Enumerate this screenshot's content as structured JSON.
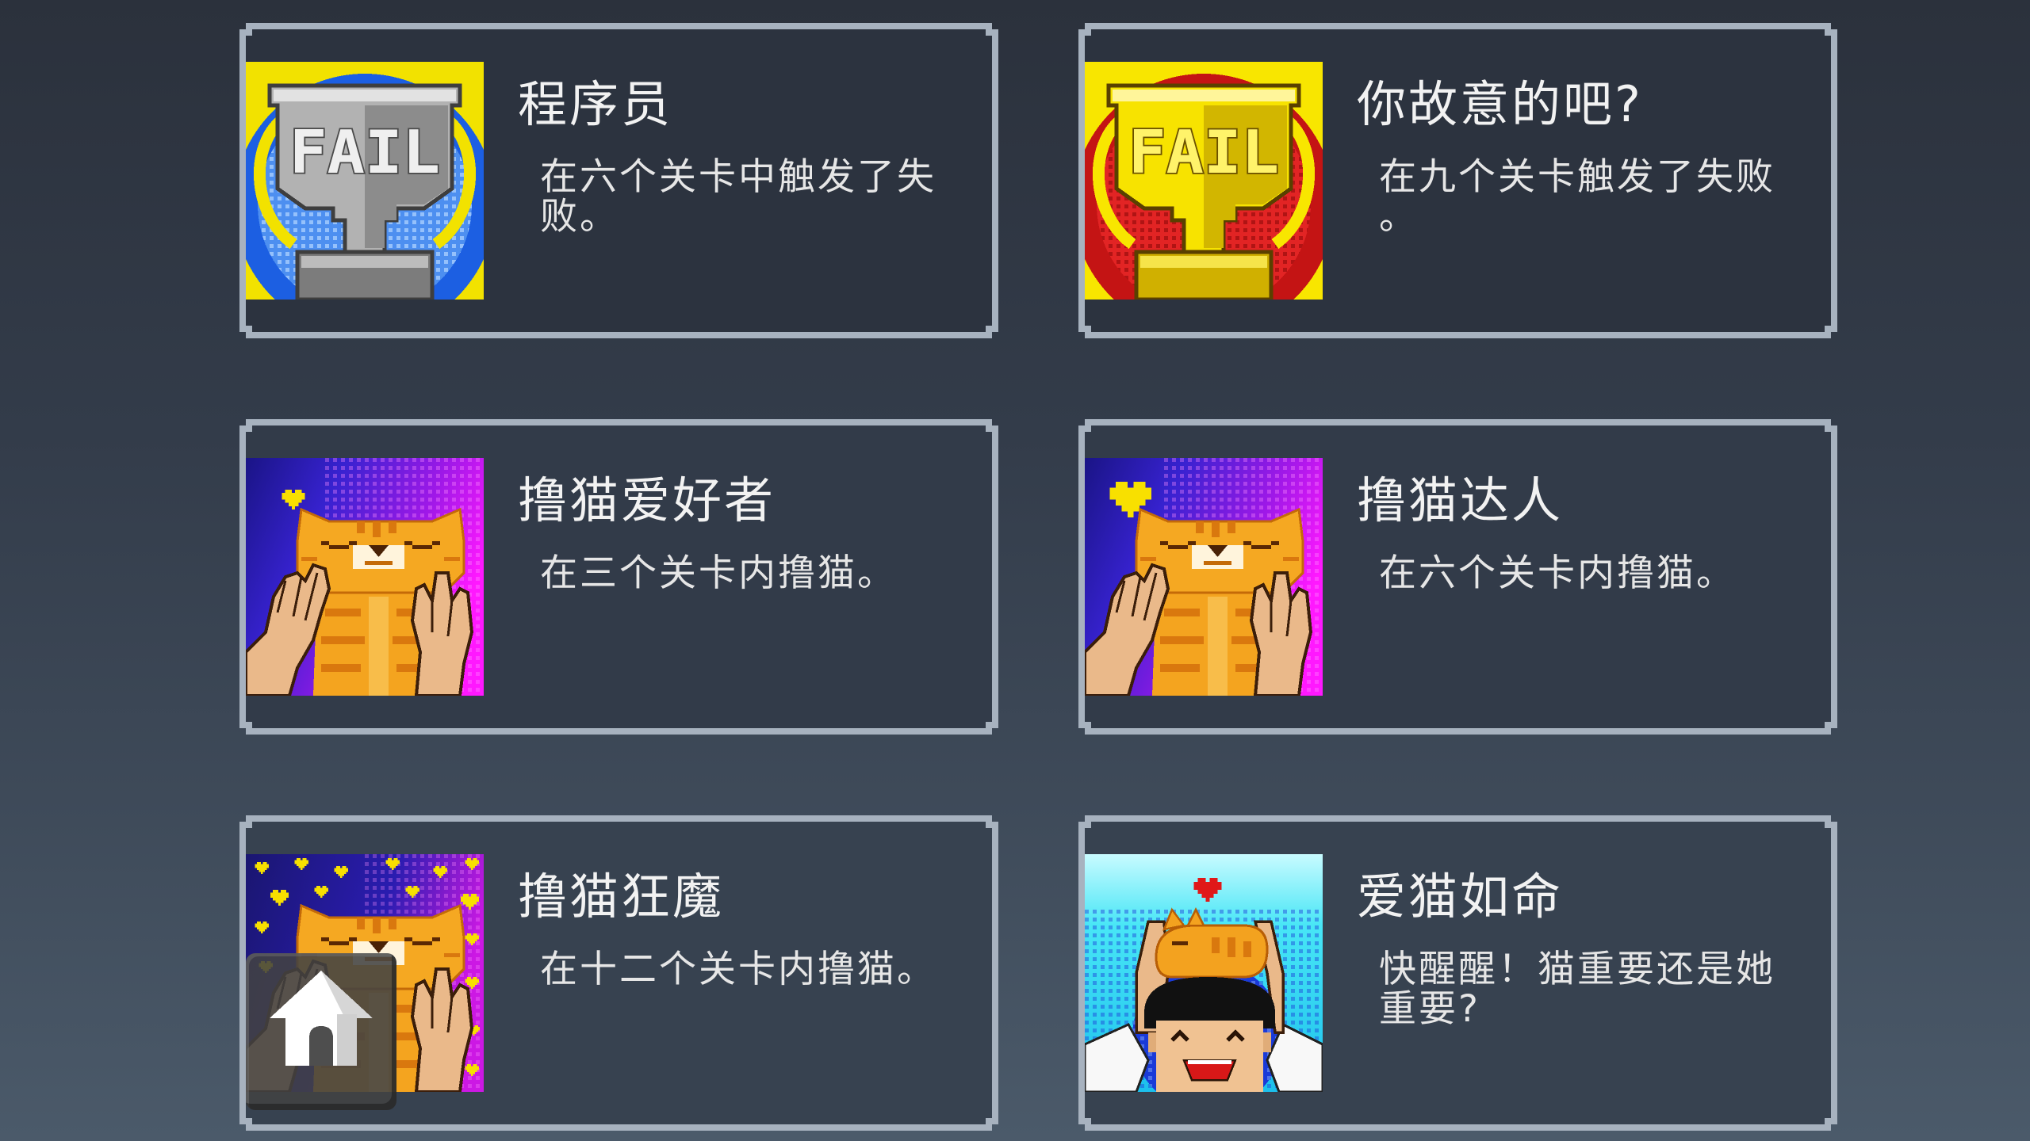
{
  "screen": "achievements",
  "achievements": [
    {
      "title": "程序员",
      "description": "在六个关卡中触发了失败。",
      "icon": "silver-fail-trophy-icon",
      "icon_text": "FAIL"
    },
    {
      "title": "你故意的吧?",
      "description": "在九个关卡触发了失败。",
      "icon": "gold-fail-trophy-icon",
      "icon_text": "FAIL"
    },
    {
      "title": "撸猫爱好者",
      "description": "在三个关卡内撸猫。",
      "icon": "petting-cat-small-heart-icon"
    },
    {
      "title": "撸猫达人",
      "description": "在六个关卡内撸猫。",
      "icon": "petting-cat-big-heart-icon"
    },
    {
      "title": "撸猫狂魔",
      "description": "在十二个关卡内撸猫。",
      "icon": "petting-cat-many-hearts-icon"
    },
    {
      "title": "爱猫如命",
      "description": "快醒醒！猫重要还是她重要?",
      "icon": "cat-on-head-icon"
    }
  ],
  "home_button": {
    "icon": "home-icon"
  },
  "colors": {
    "card_border": "#a7b2bf",
    "title_text": "#f2f2f2",
    "description_text": "#e6e6e6"
  }
}
